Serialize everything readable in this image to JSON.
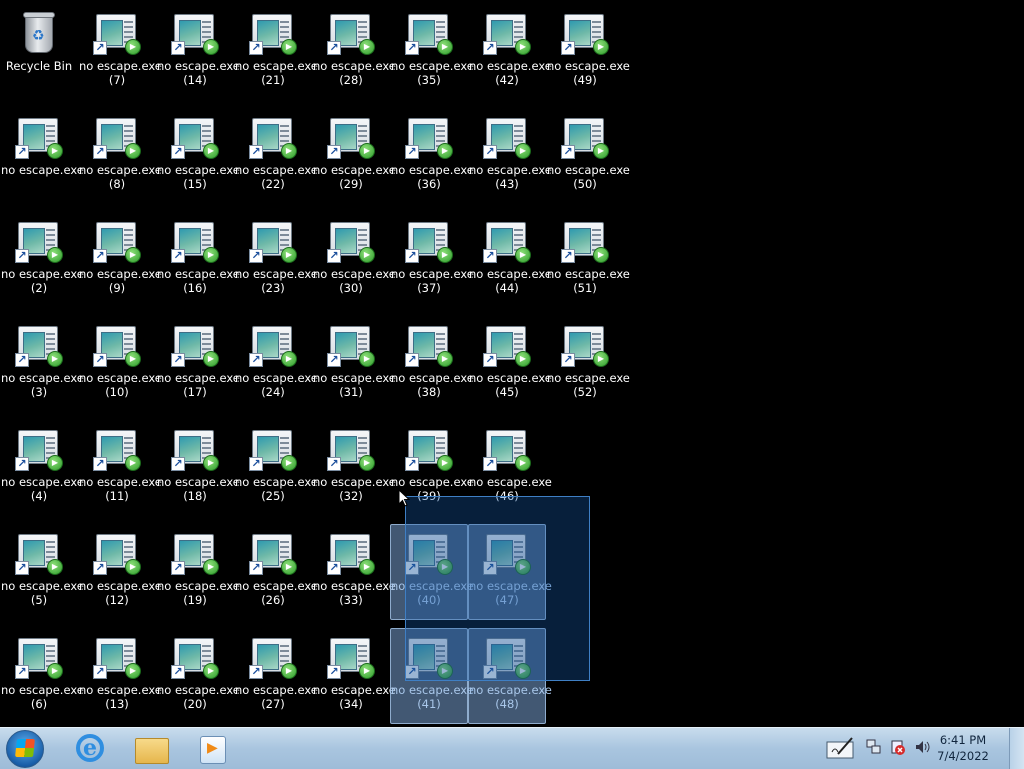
{
  "desktop": {
    "recycle_bin_label": "Recycle Bin",
    "icons": [
      {
        "name": "no escape.exe",
        "suffix": "",
        "col": 0,
        "row": 1
      },
      {
        "name": "no escape.exe",
        "suffix": "(2)",
        "col": 0,
        "row": 2
      },
      {
        "name": "no escape.exe",
        "suffix": "(3)",
        "col": 0,
        "row": 3
      },
      {
        "name": "no escape.exe",
        "suffix": "(4)",
        "col": 0,
        "row": 4
      },
      {
        "name": "no escape.exe",
        "suffix": "(5)",
        "col": 0,
        "row": 5
      },
      {
        "name": "no escape.exe",
        "suffix": "(6)",
        "col": 0,
        "row": 6
      },
      {
        "name": "no escape.exe",
        "suffix": "(7)",
        "col": 1,
        "row": 0
      },
      {
        "name": "no escape.exe",
        "suffix": "(8)",
        "col": 1,
        "row": 1
      },
      {
        "name": "no escape.exe",
        "suffix": "(9)",
        "col": 1,
        "row": 2
      },
      {
        "name": "no escape.exe",
        "suffix": "(10)",
        "col": 1,
        "row": 3
      },
      {
        "name": "no escape.exe",
        "suffix": "(11)",
        "col": 1,
        "row": 4
      },
      {
        "name": "no escape.exe",
        "suffix": "(12)",
        "col": 1,
        "row": 5
      },
      {
        "name": "no escape.exe",
        "suffix": "(13)",
        "col": 1,
        "row": 6
      },
      {
        "name": "no escape.exe",
        "suffix": "(14)",
        "col": 2,
        "row": 0
      },
      {
        "name": "no escape.exe",
        "suffix": "(15)",
        "col": 2,
        "row": 1
      },
      {
        "name": "no escape.exe",
        "suffix": "(16)",
        "col": 2,
        "row": 2
      },
      {
        "name": "no escape.exe",
        "suffix": "(17)",
        "col": 2,
        "row": 3
      },
      {
        "name": "no escape.exe",
        "suffix": "(18)",
        "col": 2,
        "row": 4
      },
      {
        "name": "no escape.exe",
        "suffix": "(19)",
        "col": 2,
        "row": 5
      },
      {
        "name": "no escape.exe",
        "suffix": "(20)",
        "col": 2,
        "row": 6
      },
      {
        "name": "no escape.exe",
        "suffix": "(21)",
        "col": 3,
        "row": 0
      },
      {
        "name": "no escape.exe",
        "suffix": "(22)",
        "col": 3,
        "row": 1
      },
      {
        "name": "no escape.exe",
        "suffix": "(23)",
        "col": 3,
        "row": 2
      },
      {
        "name": "no escape.exe",
        "suffix": "(24)",
        "col": 3,
        "row": 3
      },
      {
        "name": "no escape.exe",
        "suffix": "(25)",
        "col": 3,
        "row": 4
      },
      {
        "name": "no escape.exe",
        "suffix": "(26)",
        "col": 3,
        "row": 5
      },
      {
        "name": "no escape.exe",
        "suffix": "(27)",
        "col": 3,
        "row": 6
      },
      {
        "name": "no escape.exe",
        "suffix": "(28)",
        "col": 4,
        "row": 0
      },
      {
        "name": "no escape.exe",
        "suffix": "(29)",
        "col": 4,
        "row": 1
      },
      {
        "name": "no escape.exe",
        "suffix": "(30)",
        "col": 4,
        "row": 2
      },
      {
        "name": "no escape.exe",
        "suffix": "(31)",
        "col": 4,
        "row": 3
      },
      {
        "name": "no escape.exe",
        "suffix": "(32)",
        "col": 4,
        "row": 4
      },
      {
        "name": "no escape.exe",
        "suffix": "(33)",
        "col": 4,
        "row": 5
      },
      {
        "name": "no escape.exe",
        "suffix": "(34)",
        "col": 4,
        "row": 6
      },
      {
        "name": "no escape.exe",
        "suffix": "(35)",
        "col": 5,
        "row": 0
      },
      {
        "name": "no escape.exe",
        "suffix": "(36)",
        "col": 5,
        "row": 1
      },
      {
        "name": "no escape.exe",
        "suffix": "(37)",
        "col": 5,
        "row": 2
      },
      {
        "name": "no escape.exe",
        "suffix": "(38)",
        "col": 5,
        "row": 3
      },
      {
        "name": "no escape.exe",
        "suffix": "(39)",
        "col": 5,
        "row": 4
      },
      {
        "name": "no escape.exe",
        "suffix": "(40)",
        "col": 5,
        "row": 5,
        "selected": true
      },
      {
        "name": "no escape.exe",
        "suffix": "(41)",
        "col": 5,
        "row": 6,
        "selected": true
      },
      {
        "name": "no escape.exe",
        "suffix": "(42)",
        "col": 6,
        "row": 0
      },
      {
        "name": "no escape.exe",
        "suffix": "(43)",
        "col": 6,
        "row": 1
      },
      {
        "name": "no escape.exe",
        "suffix": "(44)",
        "col": 6,
        "row": 2
      },
      {
        "name": "no escape.exe",
        "suffix": "(45)",
        "col": 6,
        "row": 3
      },
      {
        "name": "no escape.exe",
        "suffix": "(46)",
        "col": 6,
        "row": 4
      },
      {
        "name": "no escape.exe",
        "suffix": "(47)",
        "col": 6,
        "row": 5,
        "selected": true
      },
      {
        "name": "no escape.exe",
        "suffix": "(48)",
        "col": 6,
        "row": 6,
        "selected": true
      },
      {
        "name": "no escape.exe",
        "suffix": "(49)",
        "col": 7,
        "row": 0
      },
      {
        "name": "no escape.exe",
        "suffix": "(50)",
        "col": 7,
        "row": 1
      },
      {
        "name": "no escape.exe",
        "suffix": "(51)",
        "col": 7,
        "row": 2
      },
      {
        "name": "no escape.exe",
        "suffix": "(52)",
        "col": 7,
        "row": 3
      }
    ]
  },
  "taskbar": {
    "pinned": [
      {
        "icon": "internet-explorer-icon"
      },
      {
        "icon": "windows-explorer-folder-icon"
      },
      {
        "icon": "windows-media-player-icon"
      }
    ],
    "tray_icons": [
      "action-center-icon",
      "network-icon",
      "speaker-muted-icon",
      "volume-icon"
    ],
    "clock": {
      "time": "6:41 PM",
      "date": "7/4/2022"
    }
  },
  "colors": {
    "selection": "#3f7fc4",
    "taskbar": "#a9c5df",
    "desktop_bg": "#000000"
  }
}
